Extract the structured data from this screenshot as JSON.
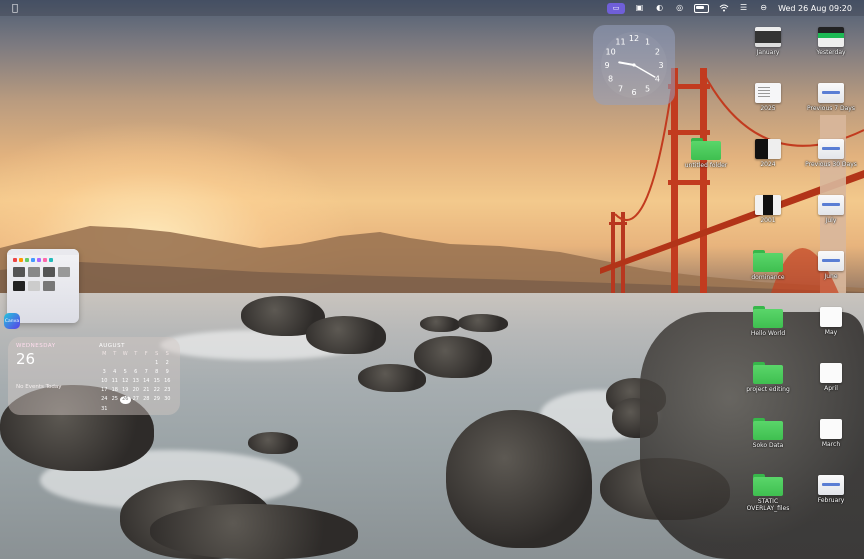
{
  "menubar": {
    "apple_icon": "apple-logo",
    "date_time": "Wed 26 Aug  09:20",
    "status_icons": [
      "screen-mirror",
      "display",
      "creative-cloud",
      "airdrop",
      "battery",
      "wifi",
      "control-center",
      "siri"
    ]
  },
  "clock": {
    "numbers": [
      "12",
      "1",
      "2",
      "3",
      "4",
      "5",
      "6",
      "7",
      "8",
      "9",
      "10",
      "11"
    ],
    "hour": 9,
    "minute": 20
  },
  "calendar": {
    "weekday": "WEDNESDAY",
    "date": "26",
    "empty_text": "No Events Today",
    "month": "AUGUST",
    "weekdays": [
      "M",
      "T",
      "W",
      "T",
      "F",
      "S",
      "S"
    ],
    "days": [
      "",
      "",
      "",
      "",
      "",
      "1",
      "2",
      "3",
      "4",
      "5",
      "6",
      "7",
      "8",
      "9",
      "10",
      "11",
      "12",
      "13",
      "14",
      "15",
      "16",
      "17",
      "18",
      "19",
      "20",
      "21",
      "22",
      "23",
      "24",
      "25",
      "26",
      "27",
      "28",
      "29",
      "30",
      "31"
    ],
    "today": "26"
  },
  "app_preview": {
    "badge": "Canva"
  },
  "desktop_icons": [
    {
      "label": "January",
      "kind": "thumb-dark"
    },
    {
      "label": "Yesterday",
      "kind": "thumb-green"
    },
    {
      "label": "2025",
      "kind": "thumb-doc"
    },
    {
      "label": "Previous 7 Days",
      "kind": "thumb-light"
    },
    {
      "label": "untitled folder",
      "kind": "folder"
    },
    {
      "label": "2024",
      "kind": "thumb-bw"
    },
    {
      "label": "Previous 30 Days",
      "kind": "thumb-light"
    },
    {
      "label": "2001",
      "kind": "thumb-phone"
    },
    {
      "label": "July",
      "kind": "thumb-light"
    },
    {
      "label": "dominance",
      "kind": "folder"
    },
    {
      "label": "June",
      "kind": "thumb-light"
    },
    {
      "label": "Hello World",
      "kind": "folder"
    },
    {
      "label": "May",
      "kind": "thumb-tile"
    },
    {
      "label": "project editing",
      "kind": "folder"
    },
    {
      "label": "April",
      "kind": "thumb-tile"
    },
    {
      "label": "Soko Data",
      "kind": "folder"
    },
    {
      "label": "March",
      "kind": "thumb-tile"
    },
    {
      "label": "STATIC OVERLAY_files",
      "kind": "folder"
    },
    {
      "label": "February",
      "kind": "thumb-light"
    }
  ]
}
